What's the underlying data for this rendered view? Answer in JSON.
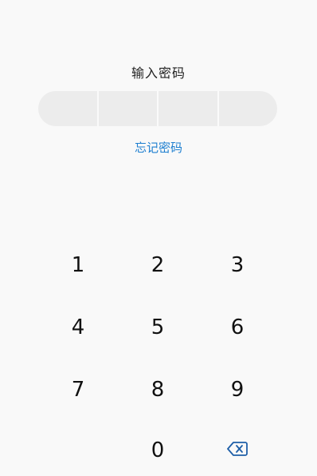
{
  "title": "输入密码",
  "forgot_link": "忘记密码",
  "pin_cells": 4,
  "keypad": {
    "k1": "1",
    "k2": "2",
    "k3": "3",
    "k4": "4",
    "k5": "5",
    "k6": "6",
    "k7": "7",
    "k8": "8",
    "k9": "9",
    "k0": "0",
    "backspace_icon": "backspace-icon"
  },
  "colors": {
    "link": "#1e7fd0",
    "background": "#f9f9f9",
    "pin_box": "#ececec"
  }
}
